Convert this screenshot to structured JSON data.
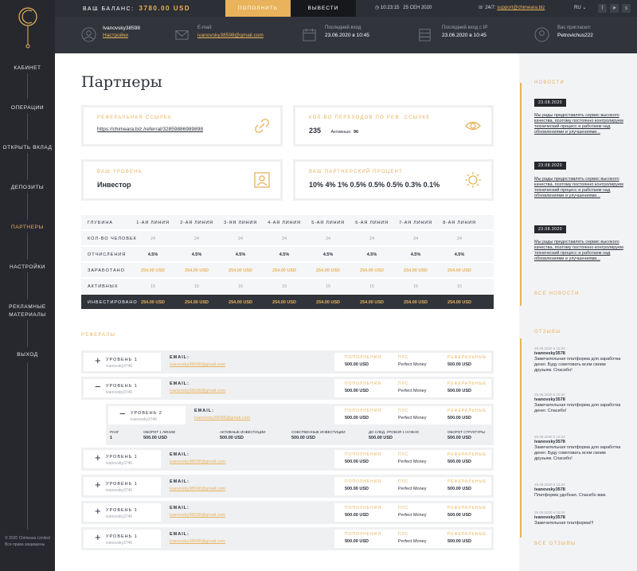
{
  "sidebar": {
    "items": [
      {
        "label": "КАБИНЕТ"
      },
      {
        "label": "ОПЕРАЦИИ"
      },
      {
        "label": "ОТКРЫТЬ ВКЛАД"
      },
      {
        "label": "ДЕПОЗИТЫ"
      },
      {
        "label": "ПАРТНЕРЫ"
      },
      {
        "label": "НАСТРОЙКИ"
      },
      {
        "label": "РЕКЛАМНЫЕ"
      },
      {
        "label": "МАТЕРИАЛЫ"
      },
      {
        "label": "ВЫХОД"
      }
    ],
    "footer_line1": "© 2020 Chimeara Limited",
    "footer_line2": "Все права защищены"
  },
  "topbar": {
    "balance_label": "ВАШ БАЛАНС:",
    "balance_value": "3780.00 USD",
    "topup_label": "ПОПОЛНИТЬ",
    "withdraw_label": "ВЫВЕСТИ",
    "time": "10:23:15",
    "date": "25 СЕН 2020",
    "support_label": "24/7:",
    "support_email": "support@chimeara.biz",
    "lang": "RU"
  },
  "infobar": {
    "username": "Ivanovsky38598",
    "settings_link": "Настройки",
    "email_label": "E-mail:",
    "email_value": "ivanovsky38598@gmail.com",
    "last_login_label": "Последний вход",
    "last_login_value": "23.06.2020 в 10:45",
    "last_ip_label": "Последний вход с IP",
    "last_ip_value": "23.06.2020 в 10:45",
    "invited_label": "Вас пригласил:",
    "invited_value": "Petrovichus222"
  },
  "page": {
    "title": "Партнеры",
    "ref_link_label": "Реферальная ссылка",
    "ref_link_value": "https://chimeara.biz./referral/32859886989898",
    "clicks_label": "Кол-во переходов по реф. ссылке",
    "clicks_value": "235",
    "active_label": "Активных:",
    "active_value": "96",
    "level_label": "Ваш уровень",
    "level_value": "Инвестор",
    "percent_label": "Ваш партнерский процент",
    "percent_value": "10% 4% 1% 0.5% 0.5% 0.5% 0.3%  0.1%"
  },
  "table": {
    "header_label": "ГЛУБИНА",
    "columns": [
      "1-АЯ ЛИНИЯ",
      "2-АЯ ЛИНИЯ",
      "3-ЯЯ ЛИНИЯ",
      "4-АЯ ЛИНИЯ",
      "5-АЯ ЛИНИЯ",
      "6-АЯ ЛИНИЯ",
      "7-АЯ ЛИНИЯ",
      "8-АЯ ЛИНИЯ"
    ],
    "rows": [
      {
        "label": "КОЛ-ВО ЧЕЛОВЕК",
        "values": [
          "24",
          "24",
          "24",
          "24",
          "24",
          "24",
          "24",
          "24"
        ]
      },
      {
        "label": "ОТЧИСЛЕНИЯ",
        "values": [
          "4.5%",
          "4.5%",
          "4.5%",
          "4.5%",
          "4.5%",
          "4.5%",
          "4.5%",
          "4.5%"
        ]
      },
      {
        "label": "ЗАРАБОТАНО",
        "values": [
          "254.00 USD",
          "254.00 USD",
          "254.00 USD",
          "254.00 USD",
          "254.00 USD",
          "254.00 USD",
          "254.00 USD",
          "254.00 USD"
        ]
      },
      {
        "label": "АКТИВНЫХ",
        "values": [
          "15",
          "15",
          "15",
          "15",
          "15",
          "15",
          "15",
          "15"
        ]
      },
      {
        "label": "ИНВЕСТИРОВАНО",
        "values": [
          "254.00 USD",
          "254.00 USD",
          "254.00 USD",
          "254.00 USD",
          "254.00 USD",
          "254.00 USD",
          "254.00 USD",
          "254.00 USD"
        ]
      }
    ]
  },
  "referrals": {
    "title": "РЕФЕРАЛЫ",
    "level_label": "УРОВЕНЬ 1",
    "level2_label": "УРОВЕНЬ 2",
    "username": "ivanovsky3746",
    "email_label": "EMAIL:",
    "email_value": "ivanovsky38598@gmail.com",
    "topup_label": "ПОПОЛНЕНИЯ",
    "topup_value": "500.00 USD",
    "ps_label": "ПЛС",
    "ps_value": "Perfect Money",
    "payouts_label": "РЕФЕРАЛЬНЫЕ",
    "payouts_value": "500.00 USD",
    "plus": "+",
    "minus": "−",
    "metrics": [
      {
        "label": "РАНГ",
        "value": "1"
      },
      {
        "label": "ОБОРОТ 1 ЛИНИИ",
        "value": "500.00 USD"
      },
      {
        "label": "АКТИВНЫЕ ИНВЕСТИЦИИ",
        "value": "500.00 USD"
      },
      {
        "label": "СОБСТВЕННЫЕ ИНВЕСТИЦИИ",
        "value": "500.00 USD"
      },
      {
        "label": "ДО СЛЕД. УРОВНЯ 1 НУЖНО",
        "value": "500.00 USD"
      },
      {
        "label": "ОБОРОТ СТРУКТУРЫ",
        "value": "500.00 USD"
      }
    ]
  },
  "news": {
    "title": "НОВОСТИ",
    "items": [
      {
        "date": "23.08.2020",
        "text": "Мы рады предоставлять сервис высокого качества, поэтому постоянно контролируем технический процесс и работаем над обновлениями и улучшениями..."
      },
      {
        "date": "23.08.2020",
        "text": "Мы рады предоставлять сервис высокого качества, поэтому постоянно контролируем технический процесс и работаем над обновлениями и улучшениями..."
      },
      {
        "date": "23.08.2020",
        "text": "Мы рады предоставлять сервис высокого качества, поэтому постоянно контролируем технический процесс и работаем над обновлениями и улучшениями..."
      }
    ],
    "all_label": "ВСЕ НОВОСТИ"
  },
  "reviews": {
    "title": "ОТЗЫВЫ",
    "items": [
      {
        "date": "29.08.2020 в 10:34",
        "name": "ivanovsky3578",
        "text": "Замечательная платформа для заработка денег. Буду советовать всем своим друзьям. Спасибо!"
      },
      {
        "date": "29.08.2020 в 10:34",
        "name": "ivanovsky3578",
        "text": "Замечательная платформа для заработка денег. Спасибо!"
      },
      {
        "date": "29.08.2020 в 10:34",
        "name": "ivanovsky3578",
        "text": "Замечательная платформа для заработка денег. Буду советовать всем своим друзьям. Спасибо!"
      },
      {
        "date": "29.08.2020 в 10:34",
        "name": "ivanovsky3578",
        "text": "Платформа удобная. Спасибо вам."
      },
      {
        "date": "29.08.2020 в 10:34",
        "name": "ivanovsky3578",
        "text": "Замечательная платформа!!!"
      }
    ],
    "all_label": "ВСЕ ОТЗЫВЫ"
  },
  "colors": {
    "accent": "#e9b35c",
    "dark": "#26282e"
  }
}
